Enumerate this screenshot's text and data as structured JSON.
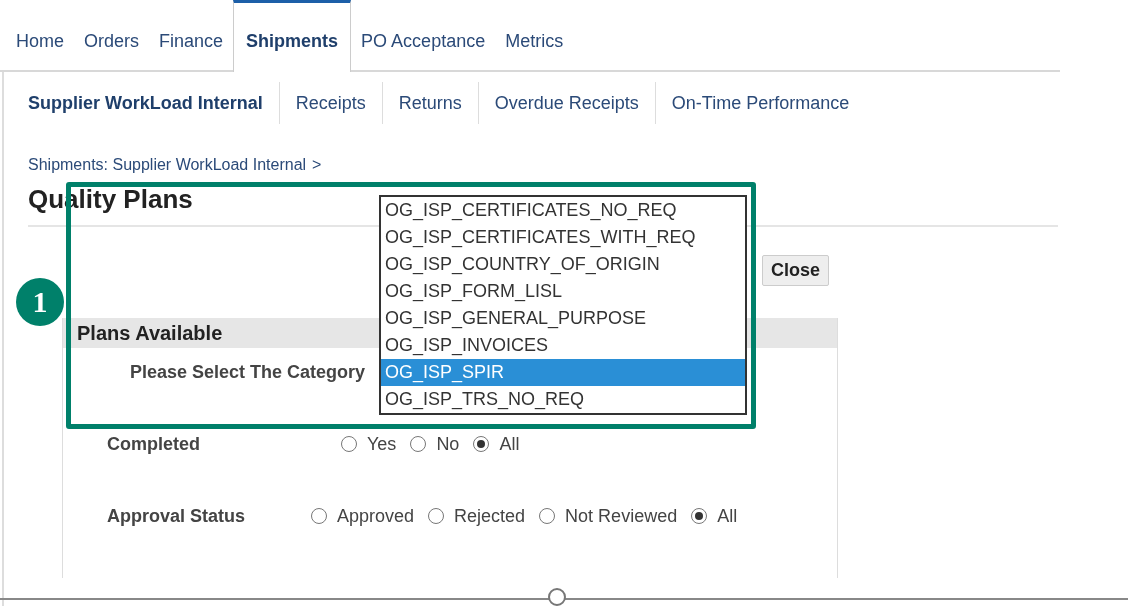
{
  "tabs": [
    {
      "label": "Home",
      "selected": false
    },
    {
      "label": "Orders",
      "selected": false
    },
    {
      "label": "Finance",
      "selected": false
    },
    {
      "label": "Shipments",
      "selected": true
    },
    {
      "label": "PO Acceptance",
      "selected": false
    },
    {
      "label": "Metrics",
      "selected": false
    }
  ],
  "subtabs": [
    {
      "label": "Supplier WorkLoad Internal",
      "selected": true
    },
    {
      "label": "Receipts",
      "selected": false
    },
    {
      "label": "Returns",
      "selected": false
    },
    {
      "label": "Overdue Receipts",
      "selected": false
    },
    {
      "label": "On-Time Performance",
      "selected": false
    }
  ],
  "breadcrumb": {
    "link": "Shipments: Supplier WorkLoad Internal",
    "separator": ">"
  },
  "title": "Quality Plans",
  "close_button": "Close",
  "section": "Plans Available",
  "category": {
    "label": "Please Select The Category",
    "options": [
      {
        "label": "OG_ISP_CERTIFICATES_NO_REQ",
        "selected": false
      },
      {
        "label": "OG_ISP_CERTIFICATES_WITH_REQ",
        "selected": false
      },
      {
        "label": "OG_ISP_COUNTRY_OF_ORIGIN",
        "selected": false
      },
      {
        "label": "OG_ISP_FORM_LISL",
        "selected": false
      },
      {
        "label": "OG_ISP_GENERAL_PURPOSE",
        "selected": false
      },
      {
        "label": "OG_ISP_INVOICES",
        "selected": false
      },
      {
        "label": "OG_ISP_SPIR",
        "selected": true
      },
      {
        "label": "OG_ISP_TRS_NO_REQ",
        "selected": false
      }
    ]
  },
  "filters": [
    {
      "label": "Completed",
      "options": [
        {
          "label": "Yes",
          "selected": false
        },
        {
          "label": "No",
          "selected": false
        },
        {
          "label": "All",
          "selected": true
        }
      ]
    },
    {
      "label": "Approval Status",
      "options": [
        {
          "label": "Approved",
          "selected": false
        },
        {
          "label": "Rejected",
          "selected": false
        },
        {
          "label": "Not Reviewed",
          "selected": false
        },
        {
          "label": "All",
          "selected": true
        }
      ]
    }
  ],
  "annotation": {
    "number": "1"
  }
}
